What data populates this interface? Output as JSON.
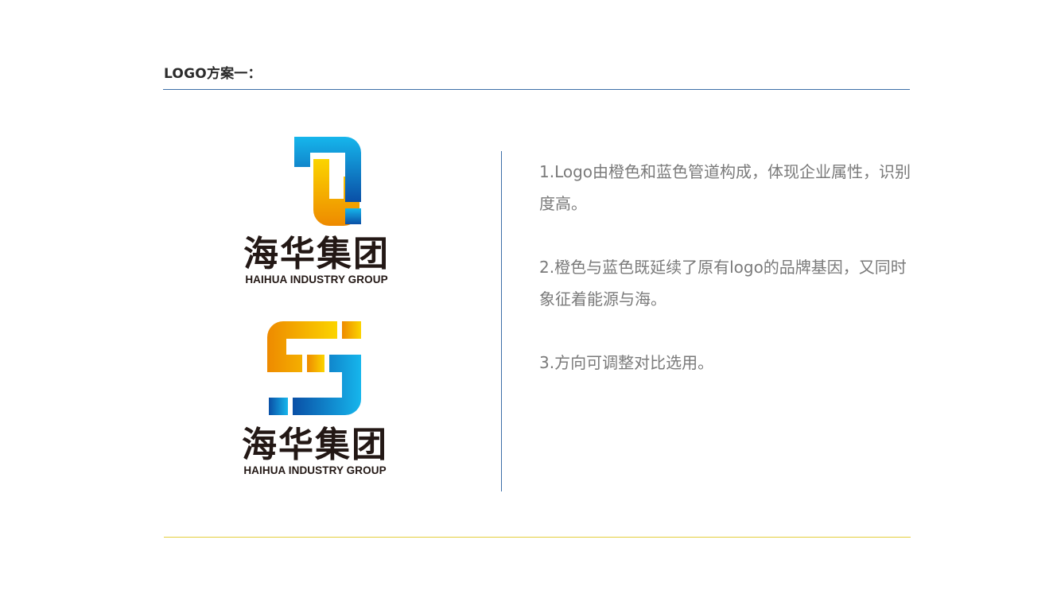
{
  "header": {
    "title": "LOGO方案一："
  },
  "logos": [
    {
      "mark_icon": "pipe-in-letters-logo-icon",
      "name_cn": "海华集团",
      "name_en": "HAIHUA INDUSTRY GROUP"
    },
    {
      "mark_icon": "pipe-s-letter-logo-icon",
      "name_cn": "海华集团",
      "name_en": "HAIHUA INDUSTRY GROUP"
    }
  ],
  "description": [
    "1.Logo由橙色和蓝色管道构成，体现企业属性，识别度高。",
    "2.橙色与蓝色既延续了原有logo的品牌基因，又同时象征着能源与海。",
    "3.方向可调整对比选用。"
  ],
  "colors": {
    "orange_light": "#fbd400",
    "orange_dark": "#ee8a00",
    "blue_light": "#16b6ec",
    "blue_dark": "#0a4fa6",
    "text_dark": "#231815",
    "text_gray": "#7a7a7a",
    "rule_blue": "#3d6fa8",
    "rule_yellow": "#e3cf3c"
  }
}
